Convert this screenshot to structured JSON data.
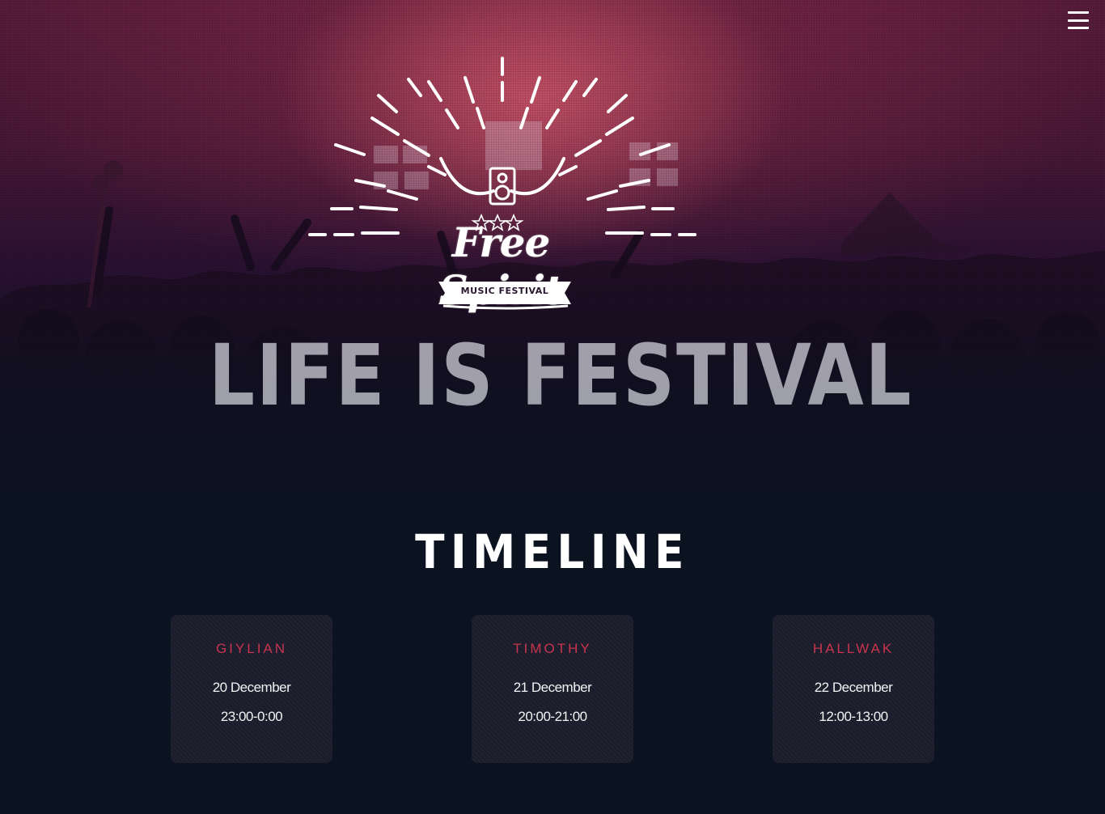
{
  "header": {
    "menu_icon": "hamburger-menu-icon"
  },
  "hero": {
    "logo": {
      "brand": "Free Spirit",
      "ribbon": "MUSIC FESTIVAL",
      "icons": [
        "speaker-icon",
        "star-icon",
        "sunburst-rays"
      ]
    },
    "headline": "LIFE IS FESTIVAL",
    "background": "concert-crowd-photo"
  },
  "timeline": {
    "title": "TIMELINE",
    "events": [
      {
        "artist": "GIYLIAN",
        "date": "20 December",
        "time": "23:00-0:00"
      },
      {
        "artist": "TIMOTHY",
        "date": "21 December",
        "time": "20:00-21:00"
      },
      {
        "artist": "HALLWAK",
        "date": "22 December",
        "time": "12:00-13:00"
      }
    ]
  },
  "colors": {
    "accent": "#c8344e",
    "background": "#0b1220",
    "card": "#1c1d2c",
    "text": "#ffffff"
  }
}
